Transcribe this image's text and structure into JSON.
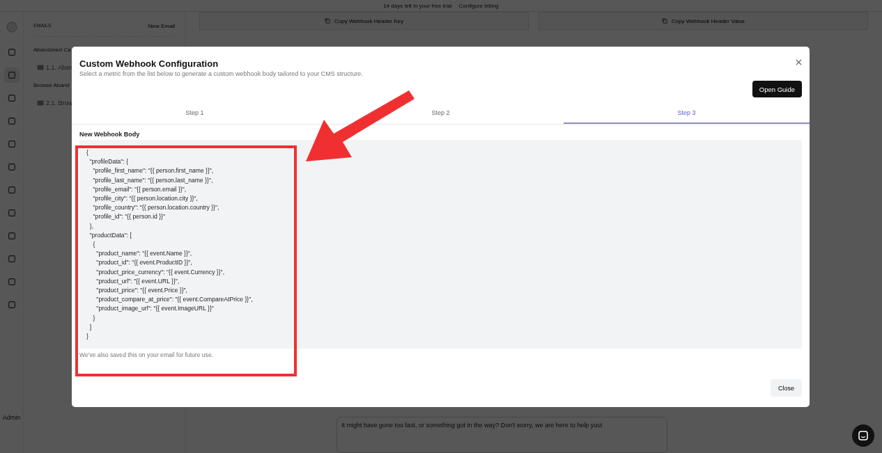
{
  "banner": {
    "text": "14 days left in your free trial",
    "link": "Configure billing"
  },
  "emails_panel": {
    "heading": "EMAILS",
    "new_button": "New Email",
    "groups": [
      {
        "title": "Abandoned Ca",
        "items": [
          "1.1. Aban"
        ]
      },
      {
        "title": "Browse Aband",
        "items": [
          "2.1. Brow"
        ]
      }
    ]
  },
  "user": "Admin",
  "copy_buttons": [
    "Copy Webhook Header Key",
    "Copy Webhook Header Value"
  ],
  "message_box": {
    "value": "It might have gone too fast, or something got in the way? Don't worry, we are here to help you!"
  },
  "modal": {
    "title": "Custom Webhook Configuration",
    "subtitle": "Select a metric from the list below to generate a custom webhook body tailored to your CMS structure.",
    "guide_button": "Open Guide",
    "tabs": [
      {
        "label": "Step 1",
        "selected": false
      },
      {
        "label": "Step 2",
        "selected": false
      },
      {
        "label": "Step 3",
        "selected": true
      }
    ],
    "body_label": "New Webhook Body",
    "code": [
      "{",
      "  \"profileData\": {",
      "    \"profile_first_name\": \"{{ person.first_name }}\",",
      "    \"profile_last_name\": \"{{ person.last_name }}\",",
      "    \"profile_email\": \"{{ person.email }}\",",
      "    \"profile_city\": \"{{ person.location.city }}\",",
      "    \"profile_country\": \"{{ person.location.country }}\",",
      "    \"profile_id\": \"{{ person.id }}\"",
      "  },",
      "  \"productData\": [",
      "    {",
      "      \"product_name\": \"{{ event.Name }}\",",
      "      \"product_id\": \"{{ event.ProductID }}\",",
      "      \"product_price_currency\": \"{{ event.Currency }}\",",
      "      \"product_url\": \"{{ event.URL }}\",",
      "      \"product_price\": \"{{ event.Price }}\",",
      "      \"product_compare_at_price\": \"{{ event.CompareAtPrice }}\",",
      "      \"product_image_url\": \"{{ event.ImageURL }}\"",
      "    }",
      "  ]",
      "}"
    ],
    "note": "We've also saved this on your email for future use.",
    "close_button": "Close"
  }
}
